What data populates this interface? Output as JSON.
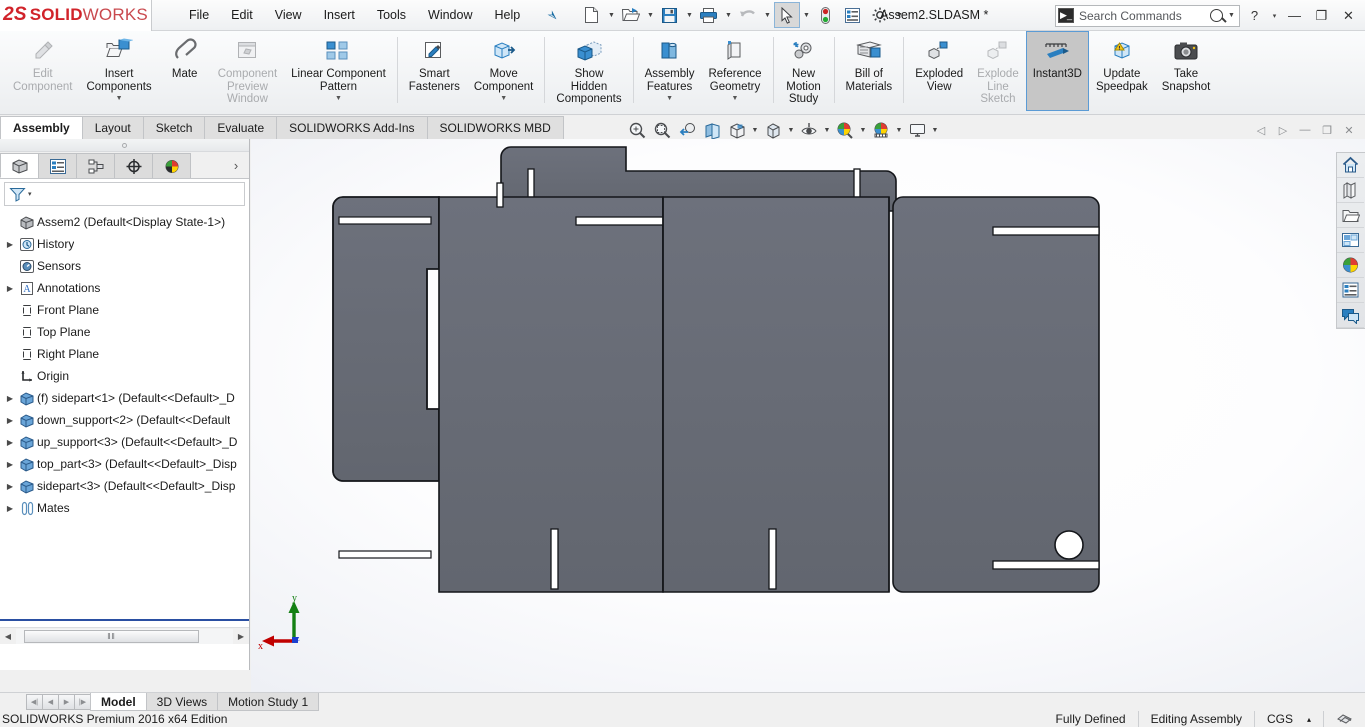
{
  "app": {
    "brand_ds": "2S",
    "brand_solid": "SOLID",
    "brand_works": "WORKS",
    "document_title": "Assem2.SLDASM *",
    "accent_red": "#d1232a",
    "accent_blue": "#5b9bd5",
    "model_fill": "#676b76",
    "model_edge": "#14161a"
  },
  "menubar": {
    "items": [
      {
        "label": "File"
      },
      {
        "label": "Edit"
      },
      {
        "label": "View"
      },
      {
        "label": "Insert"
      },
      {
        "label": "Tools"
      },
      {
        "label": "Window"
      },
      {
        "label": "Help"
      }
    ],
    "pin_icon": "pin-icon"
  },
  "quick_access": {
    "buttons": [
      {
        "name": "new-document-icon",
        "has_caret": true
      },
      {
        "name": "open-document-icon",
        "has_caret": true
      },
      {
        "name": "save-icon",
        "has_caret": true
      },
      {
        "name": "print-icon",
        "has_caret": true
      },
      {
        "name": "undo-icon",
        "has_caret": true,
        "disabled": true
      },
      {
        "name": "select-icon",
        "has_caret": true,
        "selected": true
      },
      {
        "name": "rebuild-icon",
        "has_caret": false
      },
      {
        "name": "options-list-icon",
        "has_caret": false
      },
      {
        "name": "settings-gear-icon",
        "has_caret": true
      }
    ]
  },
  "search": {
    "placeholder": "Search Commands",
    "command_icon": "command-prompt-icon",
    "magnifier_icon": "search-icon"
  },
  "window_controls": {
    "help": "?",
    "help_caret": "▾",
    "minimize": "—",
    "restore": "❐",
    "close": "✕"
  },
  "ribbon": {
    "groups": [
      {
        "buttons": [
          {
            "label": "Edit\nComponent",
            "icon": "edit-component-icon",
            "disabled": true,
            "caret": false
          },
          {
            "label": "Insert\nComponents",
            "icon": "insert-components-icon",
            "disabled": false,
            "caret": true
          },
          {
            "label": "Mate",
            "icon": "mate-icon",
            "disabled": false,
            "caret": false
          },
          {
            "label": "Component\nPreview\nWindow",
            "icon": "component-preview-window-icon",
            "disabled": true,
            "caret": false
          },
          {
            "label": "Linear Component\nPattern",
            "icon": "linear-component-pattern-icon",
            "disabled": false,
            "caret": true
          },
          {
            "label": "Smart\nFasteners",
            "icon": "smart-fasteners-icon",
            "disabled": false,
            "caret": false
          },
          {
            "label": "Move\nComponent",
            "icon": "move-component-icon",
            "disabled": false,
            "caret": true
          }
        ]
      },
      {
        "buttons": [
          {
            "label": "Show\nHidden\nComponents",
            "icon": "show-hidden-components-icon",
            "disabled": false,
            "caret": false
          }
        ]
      },
      {
        "buttons": [
          {
            "label": "Assembly\nFeatures",
            "icon": "assembly-features-icon",
            "disabled": false,
            "caret": true
          },
          {
            "label": "Reference\nGeometry",
            "icon": "reference-geometry-icon",
            "disabled": false,
            "caret": true
          }
        ]
      },
      {
        "buttons": [
          {
            "label": "New\nMotion\nStudy",
            "icon": "new-motion-study-icon",
            "disabled": false,
            "caret": false
          }
        ]
      },
      {
        "buttons": [
          {
            "label": "Bill of\nMaterials",
            "icon": "bill-of-materials-icon",
            "disabled": false,
            "caret": false
          }
        ]
      },
      {
        "buttons": [
          {
            "label": "Exploded\nView",
            "icon": "exploded-view-icon",
            "disabled": false,
            "caret": false
          },
          {
            "label": "Explode\nLine\nSketch",
            "icon": "explode-line-sketch-icon",
            "disabled": true,
            "caret": false
          },
          {
            "label": "Instant3D",
            "icon": "instant3d-icon",
            "disabled": false,
            "caret": false,
            "active": true
          },
          {
            "label": "Update\nSpeedpak",
            "icon": "update-speedpak-icon",
            "disabled": false,
            "caret": false
          },
          {
            "label": "Take\nSnapshot",
            "icon": "take-snapshot-icon",
            "disabled": false,
            "caret": false
          }
        ]
      }
    ]
  },
  "command_tabs": [
    {
      "label": "Assembly",
      "active": true
    },
    {
      "label": "Layout",
      "active": false
    },
    {
      "label": "Sketch",
      "active": false
    },
    {
      "label": "Evaluate",
      "active": false
    },
    {
      "label": "SOLIDWORKS Add-Ins",
      "active": false
    },
    {
      "label": "SOLIDWORKS MBD",
      "active": false
    }
  ],
  "view_toolbar": {
    "buttons": [
      {
        "name": "zoom-to-fit-icon",
        "caret": false
      },
      {
        "name": "zoom-to-area-icon",
        "caret": false
      },
      {
        "name": "previous-view-icon",
        "caret": false
      },
      {
        "name": "section-view-icon",
        "caret": false
      },
      {
        "name": "view-orientation-icon",
        "caret": false
      },
      {
        "name": "display-style-icon",
        "caret": true
      },
      {
        "name": "hide-show-items-icon",
        "caret": true
      },
      {
        "name": "edit-appearance-icon",
        "caret": true
      },
      {
        "name": "apply-scene-icon",
        "caret": true
      },
      {
        "name": "view-settings-icon",
        "caret": true
      }
    ]
  },
  "doc_window_controls": {
    "buttons": [
      {
        "name": "collapse-left-icon",
        "glyph": "◁"
      },
      {
        "name": "collapse-right-icon",
        "glyph": "▷"
      },
      {
        "name": "doc-minimize-icon",
        "glyph": "—"
      },
      {
        "name": "doc-restore-icon",
        "glyph": "❐"
      },
      {
        "name": "doc-close-icon",
        "glyph": "✕"
      }
    ]
  },
  "panel": {
    "tabs": [
      {
        "name": "feature-manager-tab",
        "icon": "feature-tree-icon",
        "active": true
      },
      {
        "name": "property-manager-tab",
        "icon": "property-list-icon",
        "active": false
      },
      {
        "name": "configuration-manager-tab",
        "icon": "configuration-icon",
        "active": false
      },
      {
        "name": "dimxpert-manager-tab",
        "icon": "dimxpert-icon",
        "active": false
      },
      {
        "name": "display-manager-tab",
        "icon": "display-sphere-icon",
        "active": false
      }
    ],
    "more_glyph": "›",
    "filter_icon": "filter-funnel-icon",
    "filter_caret": "▾",
    "scroll_thumb_glyph": "‖‖"
  },
  "tree": {
    "root": {
      "label": "Assem2  (Default<Display State-1>)",
      "icon": "assembly-icon"
    },
    "items": [
      {
        "label": "History",
        "icon": "history-icon",
        "arrow": true,
        "indent": 0
      },
      {
        "label": "Sensors",
        "icon": "sensors-icon",
        "arrow": false,
        "indent": 0
      },
      {
        "label": "Annotations",
        "icon": "annotations-icon",
        "arrow": true,
        "indent": 0
      },
      {
        "label": "Front Plane",
        "icon": "plane-icon",
        "arrow": false,
        "indent": 0
      },
      {
        "label": "Top Plane",
        "icon": "plane-icon",
        "arrow": false,
        "indent": 0
      },
      {
        "label": "Right Plane",
        "icon": "plane-icon",
        "arrow": false,
        "indent": 0
      },
      {
        "label": "Origin",
        "icon": "origin-icon",
        "arrow": false,
        "indent": 0
      },
      {
        "label": "(f) sidepart<1>  (Default<<Default>_D",
        "icon": "component-icon",
        "arrow": true,
        "indent": 0
      },
      {
        "label": "down_support<2>  (Default<<Default",
        "icon": "component-icon",
        "arrow": true,
        "indent": 0
      },
      {
        "label": "up_support<3>  (Default<<Default>_D",
        "icon": "component-icon",
        "arrow": true,
        "indent": 0
      },
      {
        "label": "top_part<3>  (Default<<Default>_Disp",
        "icon": "component-icon",
        "arrow": true,
        "indent": 0
      },
      {
        "label": "sidepart<3>  (Default<<Default>_Disp",
        "icon": "component-icon",
        "arrow": true,
        "indent": 0
      },
      {
        "label": "Mates",
        "icon": "mates-icon",
        "arrow": true,
        "indent": 0
      }
    ]
  },
  "task_pane": {
    "buttons": [
      {
        "name": "solidworks-resources-home-icon"
      },
      {
        "name": "design-library-icon"
      },
      {
        "name": "file-explorer-icon"
      },
      {
        "name": "view-palette-icon"
      },
      {
        "name": "appearances-scenes-icon"
      },
      {
        "name": "custom-properties-icon"
      },
      {
        "name": "solidworks-forum-icon"
      }
    ]
  },
  "triad": {
    "x_label": "x",
    "y_label": "y",
    "z_label": "z",
    "x_color": "#c00000",
    "y_color": "#148014",
    "z_color": "#1a3fd0"
  },
  "bottom_tabs": {
    "nav_buttons": [
      "◀│",
      "◀",
      "▶",
      "│▶"
    ],
    "tabs": [
      {
        "label": "Model",
        "active": true
      },
      {
        "label": "3D Views",
        "active": false
      },
      {
        "label": "Motion Study 1",
        "active": false
      }
    ]
  },
  "status_bar": {
    "edition": "SOLIDWORKS Premium 2016 x64 Edition",
    "defined_state": "Fully Defined",
    "edit_mode": "Editing Assembly",
    "units": "CGS",
    "units_caret": "▴",
    "tail_icon": "overlay-icon"
  }
}
